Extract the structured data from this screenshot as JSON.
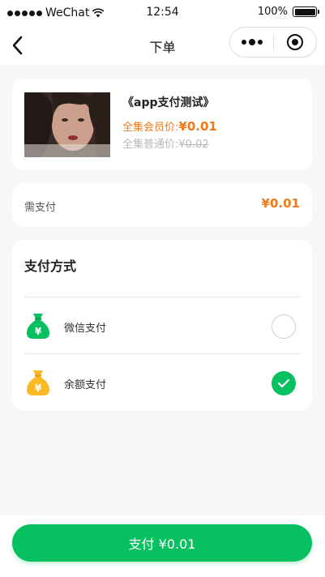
{
  "status_bar": {
    "carrier": "WeChat",
    "time": "12:54",
    "battery_percent": "100%"
  },
  "nav": {
    "title": "下单",
    "back_icon": "chevron-left-icon",
    "more_icon": "more-dots-icon",
    "close_icon": "target-icon"
  },
  "product": {
    "title": "《app支付测试》",
    "member_label": "全集会员价:",
    "member_price": "¥0.01",
    "normal_label": "全集普通价:",
    "normal_price": "¥0.02"
  },
  "payment": {
    "label": "需支付",
    "amount": "¥0.01"
  },
  "methods": {
    "title": "支付方式",
    "items": [
      {
        "label": "微信支付",
        "icon": "money-bag-icon",
        "icon_color": "#07c160",
        "selected": false
      },
      {
        "label": "余额支付",
        "icon": "money-bag-icon",
        "icon_color": "#fbb926",
        "selected": true
      }
    ]
  },
  "submit": {
    "label": "支付 ¥0.01"
  },
  "colors": {
    "accent": "#07c160",
    "price": "#f07a1a",
    "background": "#f7f7f7"
  }
}
